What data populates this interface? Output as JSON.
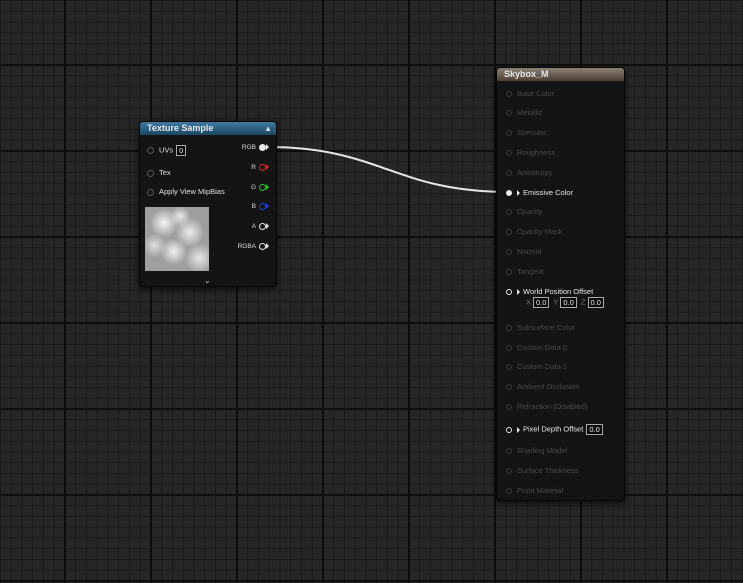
{
  "texture_node": {
    "title": "Texture Sample",
    "inputs": [
      {
        "label": "UVs",
        "value": "0"
      },
      {
        "label": "Tex"
      },
      {
        "label": "Apply View MipBias"
      }
    ],
    "outputs": [
      "RGB",
      "R",
      "G",
      "B",
      "A",
      "RGBA"
    ],
    "output_colors": [
      "#e8e8e8",
      "#d22828",
      "#28c228",
      "#2440d8",
      "#e8e8e8",
      "#e8e8e8"
    ]
  },
  "material_node": {
    "title": "Skybox_M",
    "inputs": [
      "Base Color",
      "Metallic",
      "Specular",
      "Roughness",
      "Anisotropy",
      "Emissive Color",
      "Opacity",
      "Opacity Mask",
      "Normal",
      "Tangent",
      "World Position Offset",
      "Subsurface Color",
      "Custom Data 0",
      "Custom Data 1",
      "Ambient Occlusion",
      "Refraction (Disabled)",
      "Pixel Depth Offset",
      "Shading Model",
      "Surface Thickness",
      "Front Material"
    ],
    "world_position_offset": {
      "x_label": "X",
      "x": "0.0",
      "y_label": "Y",
      "y": "0.0",
      "z_label": "Z",
      "z": "0.0"
    },
    "pixel_depth_offset_value": "0.0"
  }
}
